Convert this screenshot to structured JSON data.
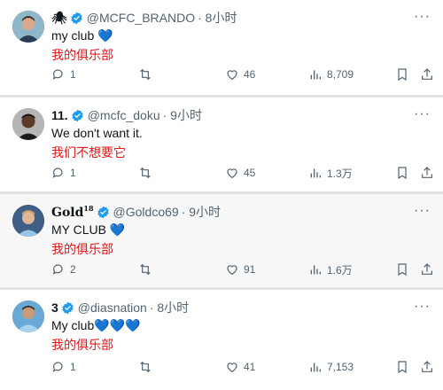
{
  "tweets": [
    {
      "name": "🕷",
      "handle": "@MCFC_BRANDO",
      "time": "· 8小时",
      "text": "my club",
      "emoji": "💙",
      "translation": "我的俱乐部",
      "replies": "1",
      "retweets": "",
      "likes": "46",
      "views": "8,709"
    },
    {
      "name": "11.",
      "handle": "@mcfc_doku",
      "time": "· 9小时",
      "text": "We don't want it.",
      "emoji": "",
      "translation": "我们不想要它",
      "replies": "1",
      "retweets": "",
      "likes": "45",
      "views": "1.3万"
    },
    {
      "name": "Gold",
      "name_sup": "18",
      "handle": "@Goldco69",
      "time": "· 9小时",
      "text": "MY CLUB",
      "emoji": "💙",
      "translation": "我的俱乐部",
      "replies": "2",
      "retweets": "",
      "likes": "91",
      "views": "1.6万"
    },
    {
      "name": "3",
      "handle": "@diasnation",
      "time": "· 8小时",
      "text": "My club",
      "emoji": "💙💙💙",
      "translation": "我的俱乐部",
      "replies": "1",
      "retweets": "",
      "likes": "41",
      "views": "7,153"
    }
  ],
  "icons": {
    "more": "more-icon",
    "verified": "verified-badge-icon",
    "reply": "reply-icon",
    "retweet": "retweet-icon",
    "like": "heart-icon",
    "views": "views-icon",
    "bookmark": "bookmark-icon",
    "share": "share-icon"
  },
  "colors": {
    "verified": "#1d9bf0",
    "translation": "#e0171a",
    "muted": "#536471",
    "heart_emoji": "#74b8e8"
  }
}
